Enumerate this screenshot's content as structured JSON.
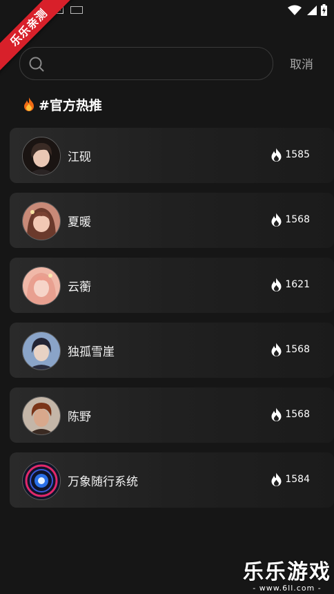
{
  "status_bar": {
    "icons": [
      "a-icon",
      "keyboard-icon",
      "wifi-icon",
      "signal-icon",
      "battery-icon"
    ]
  },
  "ribbon": {
    "text": "乐乐亲测"
  },
  "search": {
    "placeholder": "",
    "value": "",
    "cancel_label": "取消"
  },
  "section": {
    "title": "#官方热推",
    "icon": "fire-icon"
  },
  "items": [
    {
      "name": "江砚",
      "heat": "1585",
      "avatar_colors": [
        "#3a2b25",
        "#e9c7b4",
        "#2c1c16"
      ]
    },
    {
      "name": "夏暖",
      "heat": "1568",
      "avatar_colors": [
        "#6b3a2c",
        "#f1c8b4",
        "#8a4a34"
      ]
    },
    {
      "name": "云蘅",
      "heat": "1621",
      "avatar_colors": [
        "#e8a090",
        "#f6d4c8",
        "#f0b0a0"
      ]
    },
    {
      "name": "独孤雪崖",
      "heat": "1568",
      "avatar_colors": [
        "#8aa4c8",
        "#e8d2c4",
        "#2a2c3c"
      ]
    },
    {
      "name": "陈野",
      "heat": "1568",
      "avatar_colors": [
        "#c4b6a8",
        "#d8a88c",
        "#7a3418"
      ]
    },
    {
      "name": "万象随行系统",
      "heat": "1584",
      "avatar_colors": [
        "#10142a",
        "#5aa8ff",
        "#e0286a"
      ]
    }
  ],
  "watermark": {
    "main": "乐乐游戏",
    "sub": "- www.6ll.com -"
  }
}
